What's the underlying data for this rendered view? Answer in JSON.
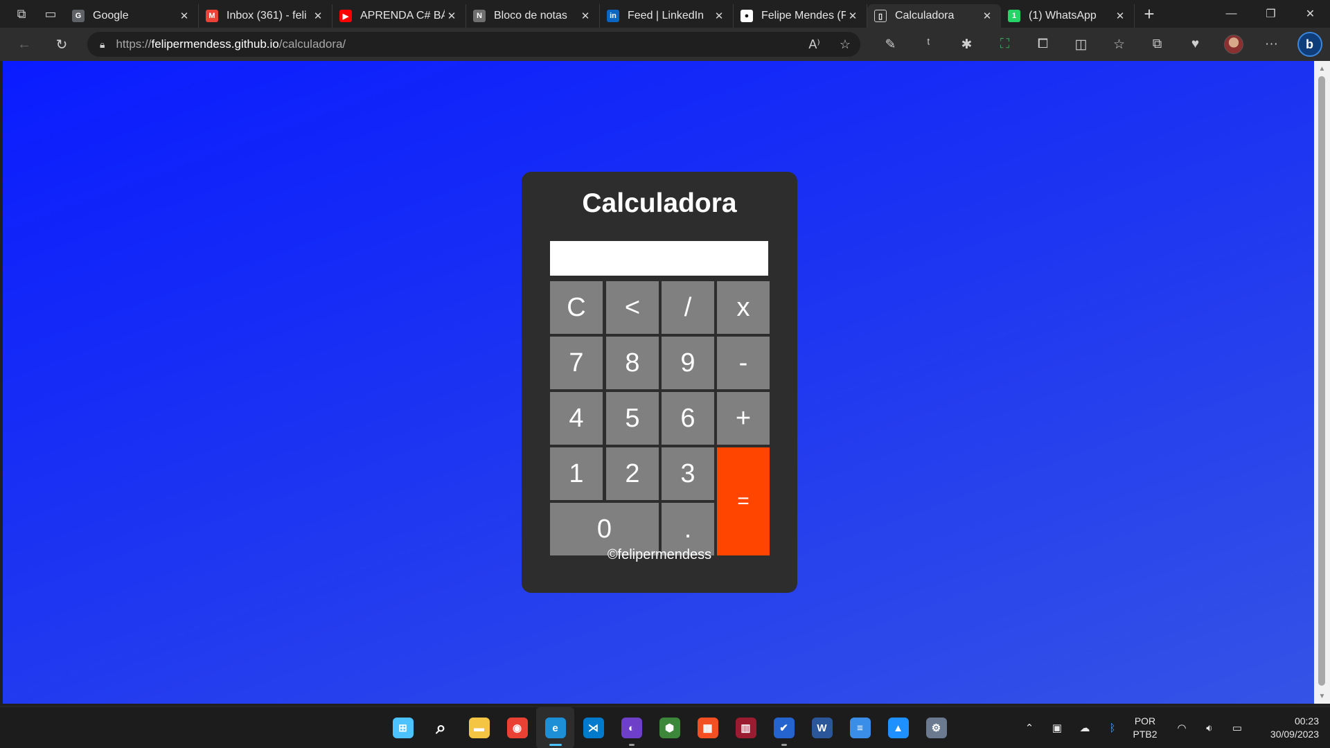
{
  "browser": {
    "tabs": [
      {
        "title": "Google",
        "icon": "google-icon",
        "color": "#5f6368",
        "glyph": "G"
      },
      {
        "title": "Inbox (361) - feli",
        "icon": "gmail-icon",
        "color": "#ea4335",
        "glyph": "M"
      },
      {
        "title": "APRENDA C# BÁ",
        "icon": "youtube-icon",
        "color": "#ff0000",
        "glyph": "▶"
      },
      {
        "title": "Bloco de notas",
        "icon": "notion-icon",
        "color": "#6f6f6f",
        "glyph": "N"
      },
      {
        "title": "Feed | LinkedIn",
        "icon": "linkedin-icon",
        "color": "#0a66c2",
        "glyph": "in"
      },
      {
        "title": "Felipe Mendes (F",
        "icon": "github-icon",
        "color": "#ffffff",
        "glyph": "●"
      },
      {
        "title": "Calculadora",
        "icon": "page-icon",
        "color": "#2e2e2e",
        "glyph": "▯",
        "active": true
      },
      {
        "title": "(1) WhatsApp",
        "icon": "whatsapp-icon",
        "color": "#25d366",
        "glyph": "1"
      }
    ],
    "url_prefix": "https://",
    "url_host": "felipermendess.github.io",
    "url_path": "/calculadora/"
  },
  "calculator": {
    "title": "Calculadora",
    "display_value": "",
    "keys": [
      "C",
      "<",
      "/",
      "x",
      "7",
      "8",
      "9",
      "-",
      "4",
      "5",
      "6",
      "+",
      "1",
      "2",
      "3",
      "=",
      "0",
      "."
    ],
    "footer": "©felipermendess",
    "equals_color": "#ff4500",
    "key_color": "#808080",
    "body_color": "#2d2d2d"
  },
  "page": {
    "gradient_start": "#0a1cff",
    "gradient_end": "#3553e6"
  },
  "taskbar": {
    "apps": [
      {
        "name": "start",
        "color": "#4cc2ff",
        "glyph": "⊞"
      },
      {
        "name": "search",
        "color": "transparent",
        "glyph": "⌕"
      },
      {
        "name": "file-explorer",
        "color": "#f4c542",
        "glyph": "▬"
      },
      {
        "name": "chrome",
        "color": "#e94235",
        "glyph": "◉"
      },
      {
        "name": "edge",
        "color": "#1c8fd6",
        "glyph": "e",
        "active": true
      },
      {
        "name": "vscode",
        "color": "#007acc",
        "glyph": "⋊"
      },
      {
        "name": "github-desktop",
        "color": "#6e40c9",
        "glyph": "◐"
      },
      {
        "name": "nodejs",
        "color": "#3c873a",
        "glyph": "⬢"
      },
      {
        "name": "microsoft-store",
        "color": "#f25022",
        "glyph": "▦"
      },
      {
        "name": "app-tool",
        "color": "#9b1b30",
        "glyph": "▥"
      },
      {
        "name": "todo",
        "color": "#2564cf",
        "glyph": "✔"
      },
      {
        "name": "word",
        "color": "#2b579a",
        "glyph": "W"
      },
      {
        "name": "notepad",
        "color": "#3b8ee8",
        "glyph": "≡"
      },
      {
        "name": "photos",
        "color": "#1e90ff",
        "glyph": "▲"
      },
      {
        "name": "settings",
        "color": "#6b7a8f",
        "glyph": "⚙"
      }
    ],
    "language_line1": "POR",
    "language_line2": "PTB2",
    "time": "00:23",
    "date": "30/09/2023"
  }
}
